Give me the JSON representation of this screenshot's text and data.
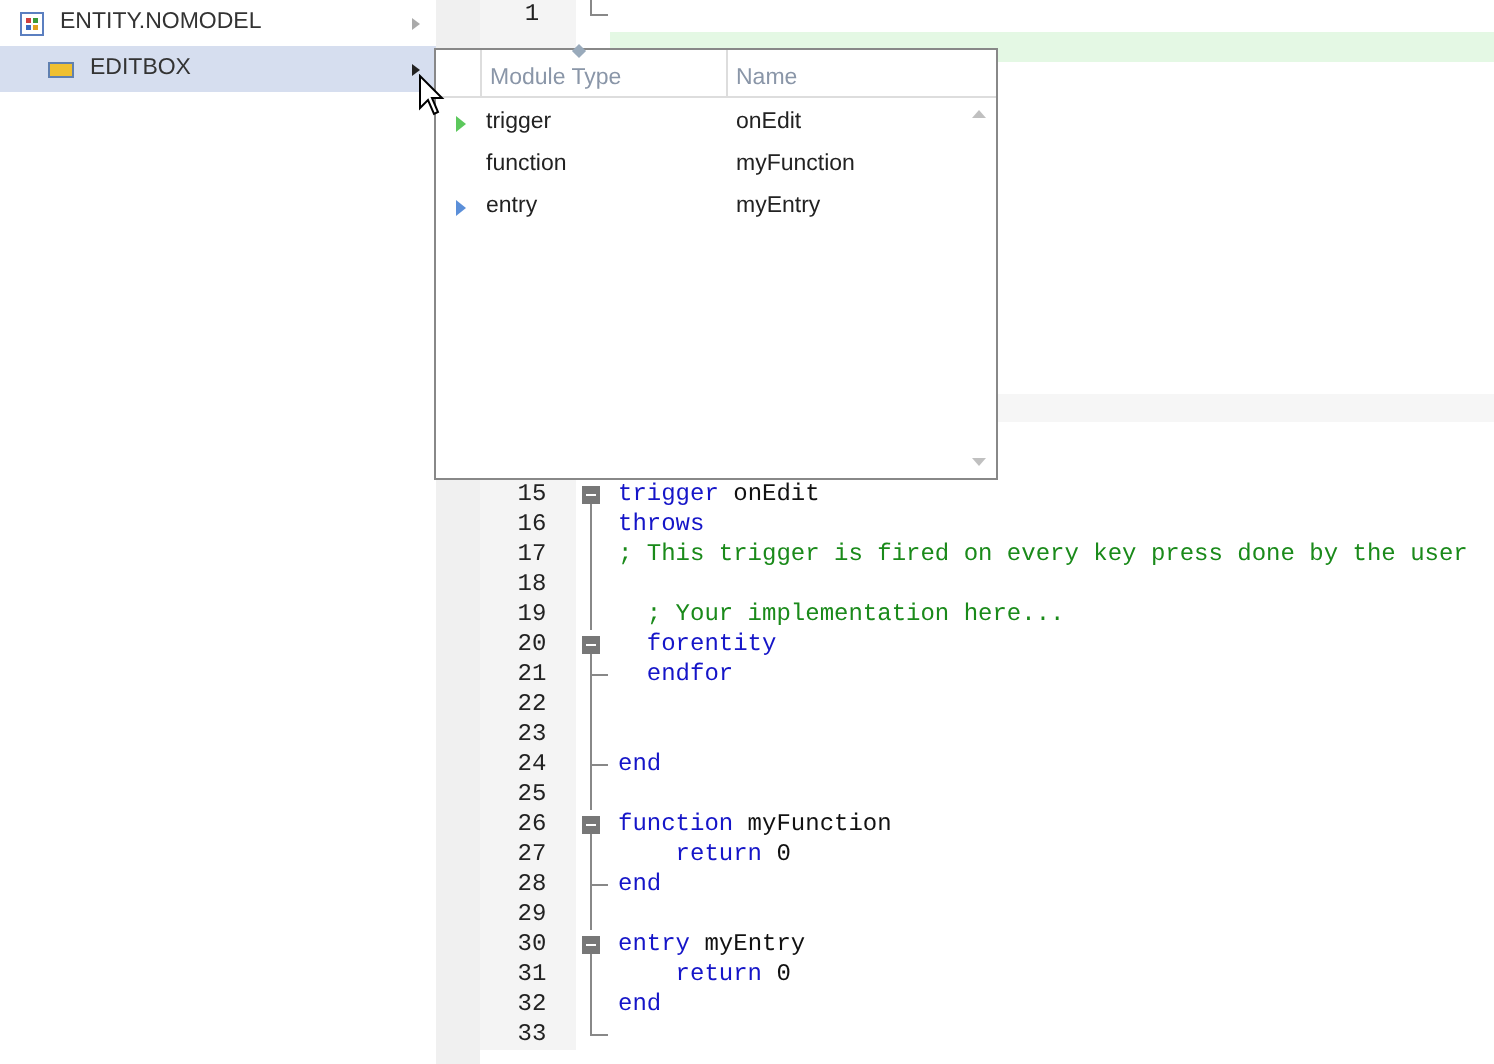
{
  "tree": {
    "items": [
      {
        "label": "ENTITY.NOMODEL",
        "kind": "entity",
        "selected": false,
        "children": [
          {
            "label": "EDITBOX",
            "kind": "field",
            "selected": true
          }
        ]
      }
    ]
  },
  "editor": {
    "highlight_band": true,
    "lines": [
      {
        "number": "1",
        "kind": "corner"
      },
      {
        "number": "15",
        "kind": "open",
        "tokens": [
          {
            "text": "trigger",
            "kind": "keyword"
          },
          {
            "text": " onEdit",
            "kind": "plain"
          }
        ]
      },
      {
        "number": "16",
        "kind": "line",
        "tokens": [
          {
            "text": "throws",
            "kind": "keyword"
          }
        ]
      },
      {
        "number": "17",
        "kind": "line",
        "tokens": [
          {
            "text": "; This trigger is fired on every key press done by the user",
            "kind": "comment"
          }
        ]
      },
      {
        "number": "18",
        "kind": "line"
      },
      {
        "number": "19",
        "kind": "line",
        "tokens": [
          {
            "text": "  ; Your implementation here...",
            "kind": "comment"
          }
        ]
      },
      {
        "number": "20",
        "kind": "open",
        "tokens": [
          {
            "text": "  forentity",
            "kind": "keyword"
          }
        ]
      },
      {
        "number": "21",
        "kind": "tee",
        "tokens": [
          {
            "text": "  endfor",
            "kind": "keyword"
          }
        ]
      },
      {
        "number": "22",
        "kind": "line"
      },
      {
        "number": "23",
        "kind": "line"
      },
      {
        "number": "24",
        "kind": "tee",
        "tokens": [
          {
            "text": "end",
            "kind": "keyword"
          }
        ]
      },
      {
        "number": "25",
        "kind": "line"
      },
      {
        "number": "26",
        "kind": "open",
        "tokens": [
          {
            "text": "function",
            "kind": "keyword"
          },
          {
            "text": " myFunction",
            "kind": "plain"
          }
        ]
      },
      {
        "number": "27",
        "kind": "line",
        "tokens": [
          {
            "text": "    return",
            "kind": "keyword"
          },
          {
            "text": " 0",
            "kind": "plain"
          }
        ]
      },
      {
        "number": "28",
        "kind": "tee",
        "tokens": [
          {
            "text": "end",
            "kind": "keyword"
          }
        ]
      },
      {
        "number": "29",
        "kind": "line"
      },
      {
        "number": "30",
        "kind": "open",
        "tokens": [
          {
            "text": "entry",
            "kind": "keyword"
          },
          {
            "text": " myEntry",
            "kind": "plain"
          }
        ]
      },
      {
        "number": "31",
        "kind": "line",
        "tokens": [
          {
            "text": "    return",
            "kind": "keyword"
          },
          {
            "text": " 0",
            "kind": "plain"
          }
        ]
      },
      {
        "number": "32",
        "kind": "line",
        "tokens": [
          {
            "text": "end",
            "kind": "keyword"
          }
        ]
      },
      {
        "number": "33",
        "kind": "corner"
      }
    ]
  },
  "popup": {
    "columns": [
      "Module Type",
      "Name"
    ],
    "rows": [
      {
        "module_type": "trigger",
        "name": "onEdit",
        "color": "#5cc85c"
      },
      {
        "module_type": "function",
        "name": "myFunction"
      },
      {
        "module_type": "entry",
        "name": "myEntry",
        "color": "#5b8fd9"
      }
    ]
  }
}
